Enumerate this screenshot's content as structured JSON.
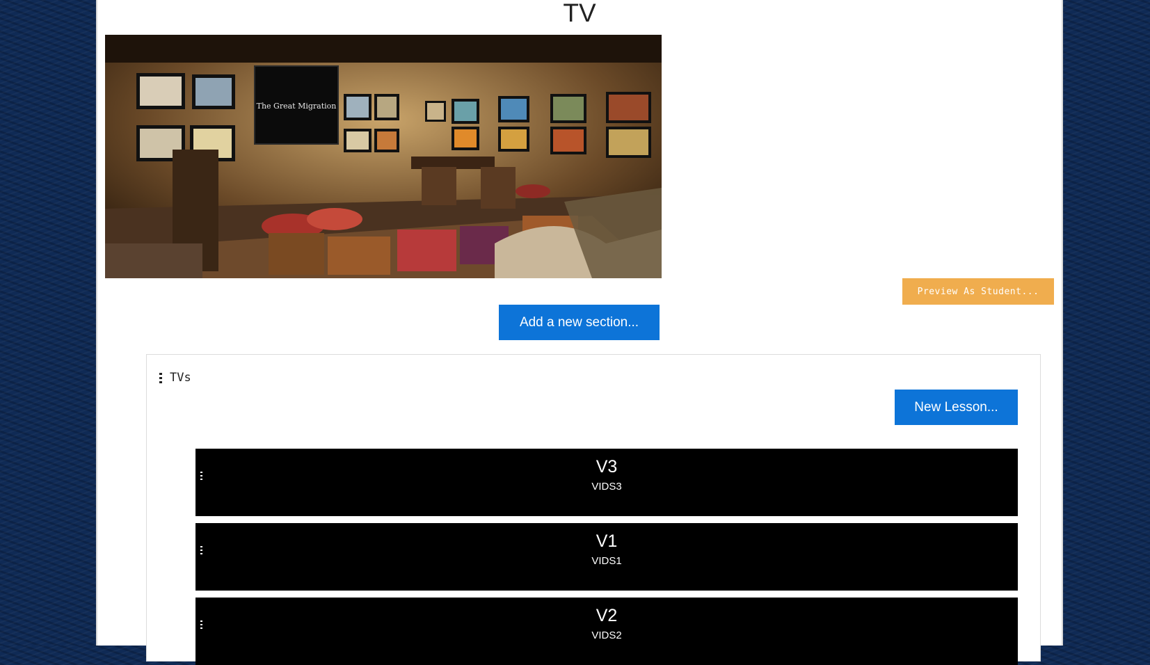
{
  "page": {
    "title": "TV"
  },
  "hero": {
    "screen_text": "The Great Migration",
    "alt": "TV"
  },
  "buttons": {
    "preview_label": "Preview As Student...",
    "add_section_label": "Add a new section...",
    "new_lesson_label": "New Lesson..."
  },
  "section": {
    "title": "TVs",
    "lessons": [
      {
        "name": "V3",
        "subtitle": "VIDS3"
      },
      {
        "name": "V1",
        "subtitle": "VIDS1"
      },
      {
        "name": "V2",
        "subtitle": "VIDS2"
      }
    ]
  },
  "colors": {
    "primary": "#0d74d8",
    "warning": "#f0ad4e",
    "background": "#0f2a55",
    "lesson_bg": "#000000"
  }
}
